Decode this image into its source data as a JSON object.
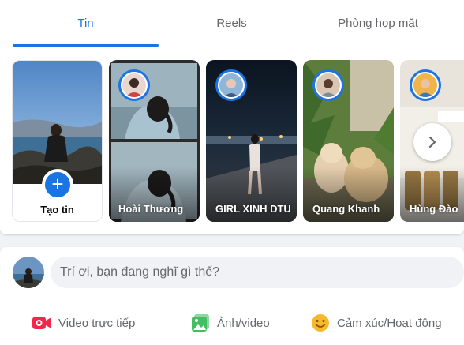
{
  "tabs": [
    {
      "label": "Tin",
      "active": true
    },
    {
      "label": "Reels",
      "active": false
    },
    {
      "label": "Phòng họp mặt",
      "active": false
    }
  ],
  "create_story": {
    "label": "Tạo tin",
    "plus": "+"
  },
  "stories": [
    {
      "name": "Hoài Thương"
    },
    {
      "name": "GIRL XINH DTU"
    },
    {
      "name": "Quang Khanh"
    },
    {
      "name": "Hùng Đào"
    }
  ],
  "composer": {
    "placeholder": "Trí ơi, bạn đang nghĩ gì thế?",
    "actions": [
      {
        "label": "Video trực tiếp",
        "icon": "live-video-icon",
        "color": "#f02849"
      },
      {
        "label": "Ảnh/video",
        "icon": "photo-video-icon",
        "color": "#45bd62"
      },
      {
        "label": "Cảm xúc/Hoạt động",
        "icon": "feeling-icon",
        "color": "#f7b928"
      }
    ]
  },
  "colors": {
    "accent": "#1b74e4",
    "muted": "#65676b",
    "background": "#f0f2f5"
  }
}
